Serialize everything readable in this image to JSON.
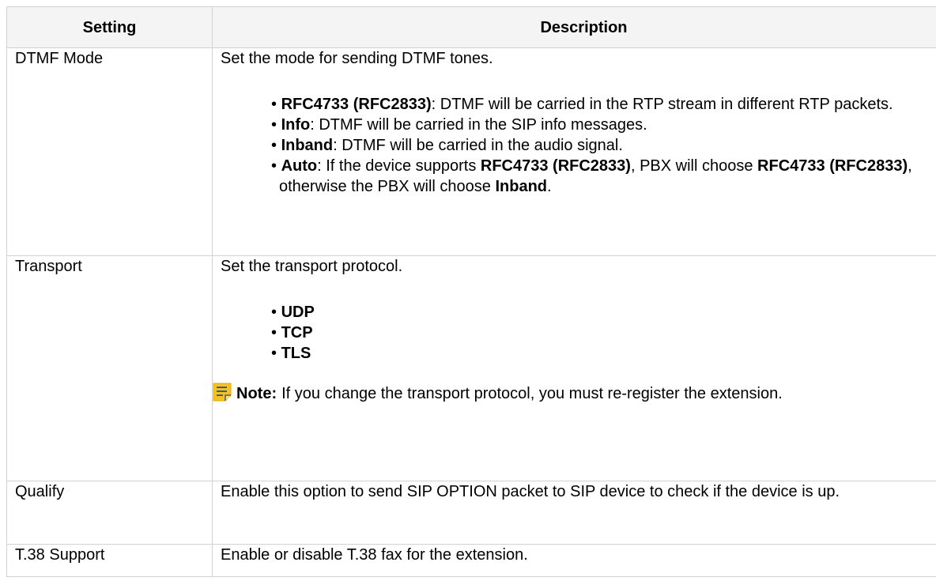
{
  "table": {
    "headers": {
      "setting": "Setting",
      "description": "Description"
    },
    "dtmf": {
      "setting": "DTMF Mode",
      "intro": "Set the mode for sending DTMF tones.",
      "opt1_name": "RFC4733 (RFC2833)",
      "opt1_text": ": DTMF will be carried in the RTP stream in different RTP packets.",
      "opt2_name": "Info",
      "opt2_text": ": DTMF will be carried in the SIP info messages.",
      "opt3_name": "Inband",
      "opt3_text": ": DTMF will be carried in the audio signal.",
      "opt4_name": "Auto",
      "opt4_text_a": ": If the device supports ",
      "opt4_bold_b": "RFC4733 (RFC2833)",
      "opt4_text_c": ", PBX will choose ",
      "opt4_bold_d": "RFC4733 (RFC2833)",
      "opt4_text_e": ", otherwise the PBX will choose ",
      "opt4_bold_f": "Inband",
      "opt4_text_g": "."
    },
    "transport": {
      "setting": "Transport",
      "intro": "Set the transport protocol.",
      "options": [
        "UDP",
        "TCP",
        "TLS"
      ],
      "note_label": "Note:",
      "note_text": "If you change the transport protocol, you must re-register the extension.",
      "note_icon": "note-icon",
      "note_icon_color": "#f7c21b"
    },
    "qualify": {
      "setting": "Qualify",
      "description": "Enable this option to send SIP OPTION packet to SIP device to check if the device is up."
    },
    "t38": {
      "setting": "T.38 Support",
      "description": "Enable or disable T.38 fax for the extension."
    }
  }
}
